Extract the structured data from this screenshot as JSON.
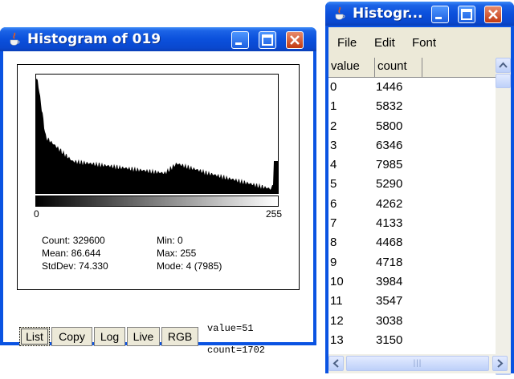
{
  "histogram_window": {
    "title": "Histogram of 019",
    "axis": {
      "min_label": "0",
      "max_label": "255"
    },
    "stats": {
      "count": "Count: 329600",
      "mean": "Mean: 86.644",
      "stddev": "StdDev: 74.330",
      "min": "Min: 0",
      "max": "Max: 255",
      "mode": "Mode: 4 (7985)"
    },
    "buttons": {
      "list": "List",
      "copy": "Copy",
      "log": "Log",
      "live": "Live",
      "rgb": "RGB"
    },
    "readout": {
      "value": "value=51",
      "count": "count=1702"
    }
  },
  "table_window": {
    "title": "Histogr...",
    "menu": {
      "file": "File",
      "edit": "Edit",
      "font": "Font"
    },
    "columns": [
      "value",
      "count"
    ],
    "rows": [
      [
        "0",
        "1446"
      ],
      [
        "1",
        "5832"
      ],
      [
        "2",
        "5800"
      ],
      [
        "3",
        "6346"
      ],
      [
        "4",
        "7985"
      ],
      [
        "5",
        "5290"
      ],
      [
        "6",
        "4262"
      ],
      [
        "7",
        "4133"
      ],
      [
        "8",
        "4468"
      ],
      [
        "9",
        "4718"
      ],
      [
        "10",
        "3984"
      ],
      [
        "11",
        "3547"
      ],
      [
        "12",
        "3038"
      ],
      [
        "13",
        "3150"
      ]
    ]
  },
  "colors": {
    "title_bar": "#0a53e2",
    "close_button": "#c23a12",
    "window_face": "#ece9d8"
  }
}
